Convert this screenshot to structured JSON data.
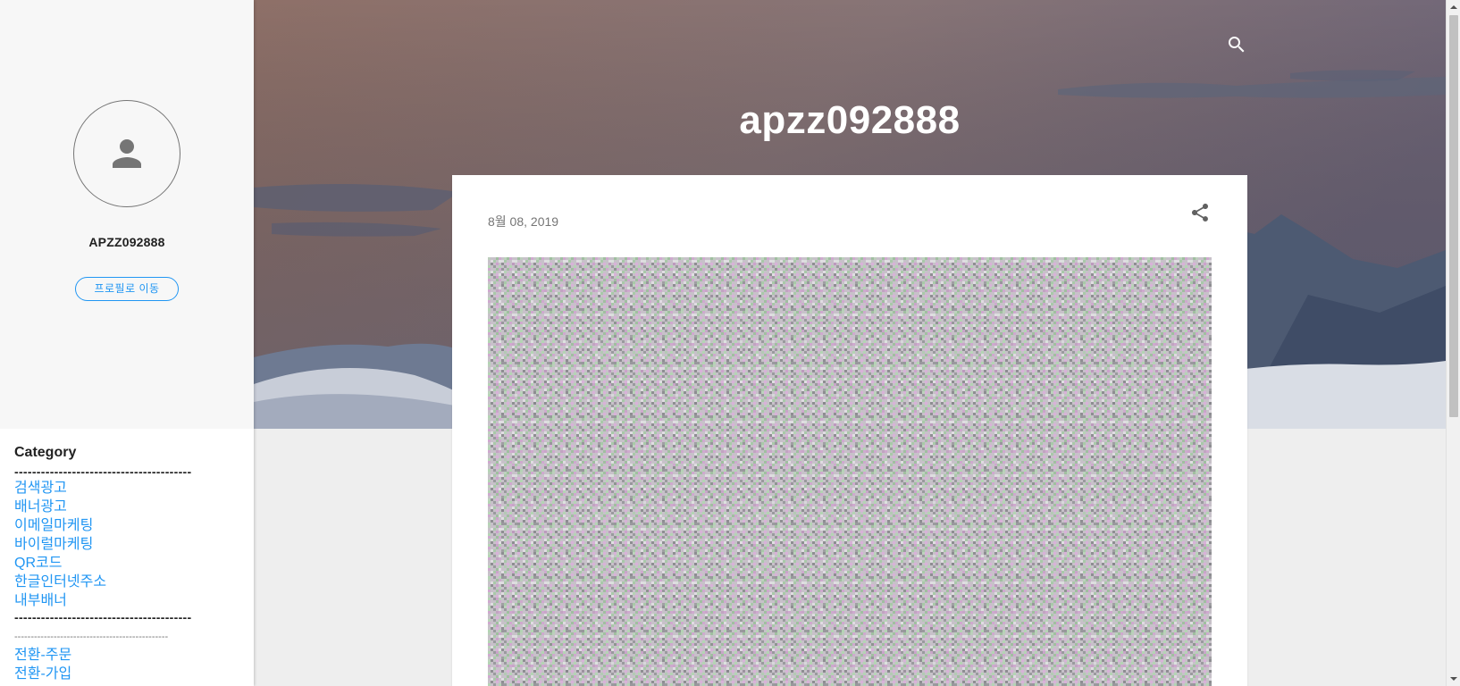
{
  "profile": {
    "name": "APZZ092888",
    "button_label": "프로필로 이동",
    "icon": "person-icon"
  },
  "sidebar": {
    "category_title": "Category",
    "separator_bold": "----------------------------------------",
    "links": [
      "검색광고",
      "배너광고",
      "이메일마케팅",
      "바이럴마케팅",
      "QR코드",
      "한글인터넷주소",
      "내부배너"
    ],
    "separator_bold_2": "----------------------------------------",
    "separator_thin": "-----------------------------------------------",
    "links_2": [
      "전환-주문",
      "전환-가입"
    ]
  },
  "header": {
    "title": "apzz092888",
    "search_icon": "search-icon"
  },
  "post": {
    "date": "8월 08, 2019",
    "share_icon": "share-icon"
  },
  "colors": {
    "accent": "#2196f3",
    "sidebar_bg": "#f7f7f7",
    "page_bg": "#eeeeee"
  }
}
